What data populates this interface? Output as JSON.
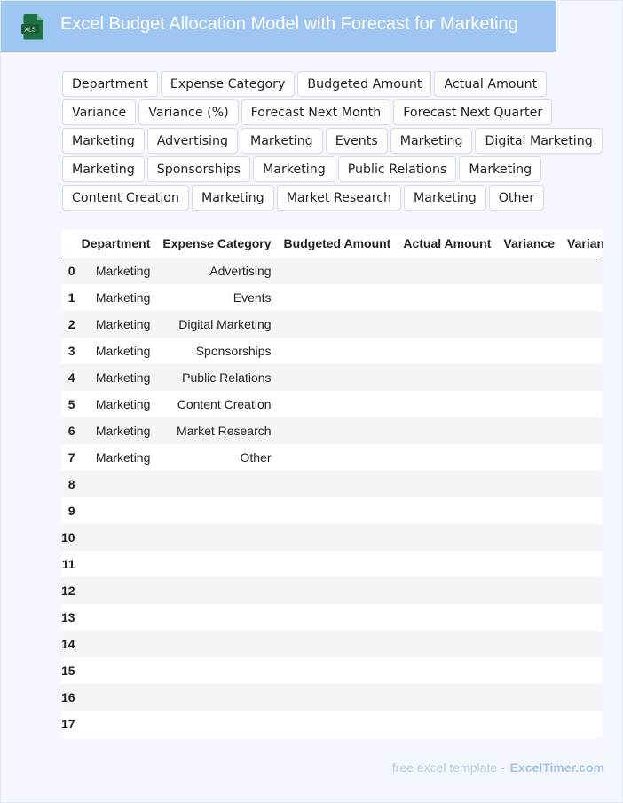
{
  "header": {
    "title": "Excel Budget Allocation Model with Forecast for Marketing",
    "icon_label": "XLS",
    "icon_color": "#1e7145",
    "bar_color": "#9fc5f2"
  },
  "tags": [
    "Department",
    "Expense Category",
    "Budgeted Amount",
    "Actual Amount",
    "Variance",
    "Variance (%)",
    "Forecast Next Month",
    "Forecast Next Quarter",
    "Marketing",
    "Advertising",
    "Marketing",
    "Events",
    "Marketing",
    "Digital Marketing",
    "Marketing",
    "Sponsorships",
    "Marketing",
    "Public Relations",
    "Marketing",
    "Content Creation",
    "Marketing",
    "Market Research",
    "Marketing",
    "Other"
  ],
  "table": {
    "columns": [
      "",
      "Department",
      "Expense Category",
      "Budgeted Amount",
      "Actual Amount",
      "Variance",
      "Variance (%)"
    ],
    "rows": [
      {
        "idx": "0",
        "department": "Marketing",
        "category": "Advertising"
      },
      {
        "idx": "1",
        "department": "Marketing",
        "category": "Events"
      },
      {
        "idx": "2",
        "department": "Marketing",
        "category": "Digital Marketing"
      },
      {
        "idx": "3",
        "department": "Marketing",
        "category": "Sponsorships"
      },
      {
        "idx": "4",
        "department": "Marketing",
        "category": "Public Relations"
      },
      {
        "idx": "5",
        "department": "Marketing",
        "category": "Content Creation"
      },
      {
        "idx": "6",
        "department": "Marketing",
        "category": "Market Research"
      },
      {
        "idx": "7",
        "department": "Marketing",
        "category": "Other"
      },
      {
        "idx": "8",
        "department": "",
        "category": ""
      },
      {
        "idx": "9",
        "department": "",
        "category": ""
      },
      {
        "idx": "10",
        "department": "",
        "category": ""
      },
      {
        "idx": "11",
        "department": "",
        "category": ""
      },
      {
        "idx": "12",
        "department": "",
        "category": ""
      },
      {
        "idx": "13",
        "department": "",
        "category": ""
      },
      {
        "idx": "14",
        "department": "",
        "category": ""
      },
      {
        "idx": "15",
        "department": "",
        "category": ""
      },
      {
        "idx": "16",
        "department": "",
        "category": ""
      },
      {
        "idx": "17",
        "department": "",
        "category": ""
      }
    ]
  },
  "footer": {
    "text": "free excel template -",
    "brand": "ExcelTimer.com"
  }
}
